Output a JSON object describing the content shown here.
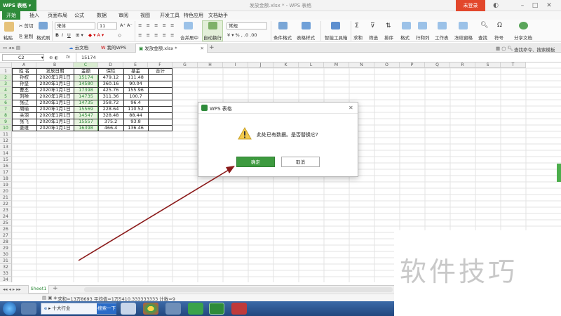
{
  "app": {
    "name": "WPS 表格",
    "doc_title": "发放金额.xlsx * - WPS 表格",
    "login": "未登录"
  },
  "menu": [
    "开始",
    "插入",
    "页面布局",
    "公式",
    "数据",
    "审阅",
    "视图",
    "开发工具",
    "特色应用",
    "文档助手"
  ],
  "ribbon": {
    "paste": "粘贴",
    "cut": "剪切",
    "copy": "复制",
    "format_painter": "格式刷",
    "font_name": "宋体",
    "font_size": "11",
    "merge": "合并居中",
    "wrap": "自动换行",
    "number_format": "常规",
    "cond_format": "条件格式",
    "table_style": "表格样式",
    "smart_toolbox": "智能工具箱",
    "sum": "求和",
    "filter": "筛选",
    "sort": "排序",
    "format": "格式",
    "rowcol": "行和列",
    "worksheet": "工作表",
    "freeze": "冻结窗格",
    "find": "查找",
    "symbol": "符号",
    "share": "分享文档"
  },
  "tabs": [
    "云文档",
    "我的WPS",
    "发放金额.xlsx *"
  ],
  "tab_search": "查找命令、搜索模板",
  "formula_bar": {
    "cell_ref": "C2",
    "fx": "fx",
    "value": "15174"
  },
  "sheet": {
    "columns": [
      "A",
      "B",
      "C",
      "D",
      "E",
      "F",
      "G",
      "H",
      "I",
      "J",
      "K",
      "L",
      "M",
      "N",
      "O",
      "P",
      "Q",
      "R",
      "S",
      "T"
    ],
    "headers": [
      "姓 名",
      "发放日期",
      "金额",
      "保险",
      "基金",
      "合计"
    ],
    "rows": [
      [
        "孙权",
        "2020年1月1日",
        "15174",
        "479.12",
        "111.48"
      ],
      [
        "孙坚",
        "2020年1月1日",
        "14580",
        "360.16",
        "90.04"
      ],
      [
        "曹丕",
        "2020年1月1日",
        "17398",
        "425.76",
        "155.96"
      ],
      [
        "刘禅",
        "2020年1月1日",
        "14735",
        "311.36",
        "100.7"
      ],
      [
        "张辽",
        "2020年1月1日",
        "14735",
        "358.72",
        "96.4"
      ],
      [
        "周瑜",
        "2020年1月1日",
        "15569",
        "228.64",
        "110.52"
      ],
      [
        "关羽",
        "2020年1月1日",
        "14547",
        "328.48",
        "88.44"
      ],
      [
        "张飞",
        "2020年1月1日",
        "15557",
        "375.2",
        "93.8"
      ],
      [
        "姜维",
        "2020年1月1日",
        "16398",
        "466.4",
        "136.46"
      ]
    ],
    "row_numbers": [
      "1",
      "2",
      "3",
      "4",
      "5",
      "6",
      "7",
      "8",
      "9",
      "10",
      "11",
      "12",
      "13",
      "14",
      "15",
      "16",
      "17",
      "18",
      "19",
      "20",
      "21",
      "22",
      "23",
      "24",
      "25",
      "26",
      "27",
      "28",
      "29",
      "30",
      "31",
      "32",
      "33",
      "34"
    ],
    "sheet_tab": "Sheet1"
  },
  "status": "求和=13万8693    平均值=1万5410.333333333    计数=9",
  "dialog": {
    "title": "WPS 表格",
    "message": "此处已有数据。是否替换它?",
    "ok": "确定",
    "cancel": "取消"
  },
  "taskbar": {
    "ie_label": "十大行业",
    "search_btn": "搜索一下"
  },
  "watermark": "软件技巧",
  "colors": {
    "wps_green": "#2e8b3a",
    "login_red": "#e2472b",
    "ok_green": "#3d9a3f",
    "arrow": "#8b1a1a"
  }
}
